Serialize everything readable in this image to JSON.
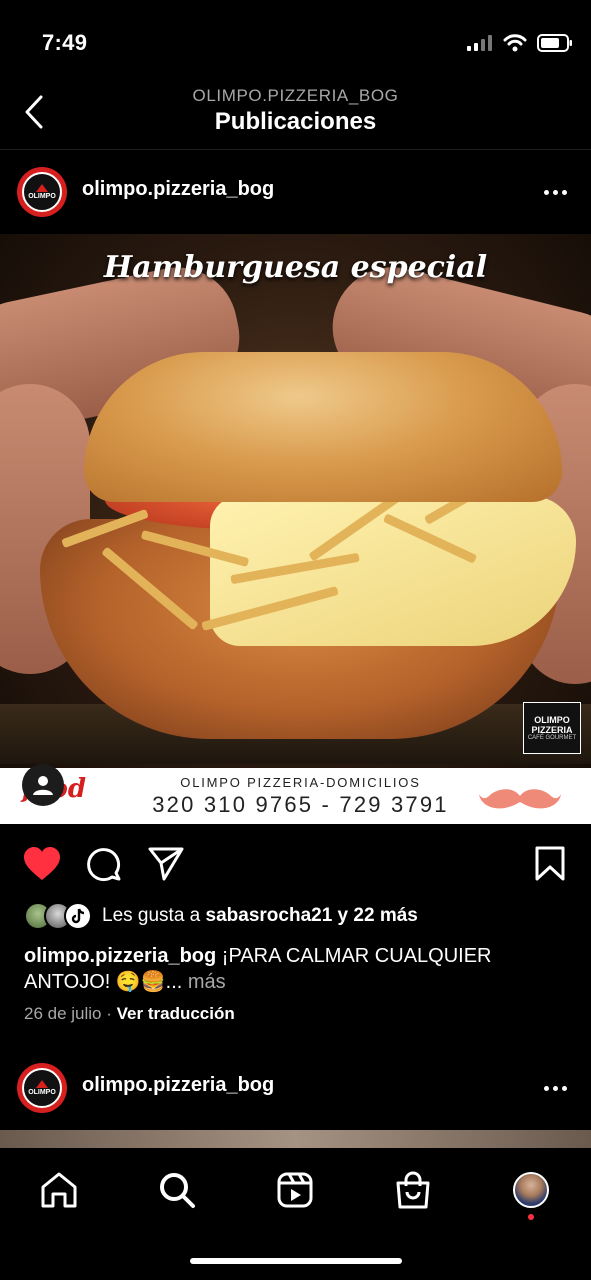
{
  "status_bar": {
    "time": "7:49"
  },
  "header": {
    "subtitle": "OLIMPO.PIZZERIA_BOG",
    "title": "Publicaciones"
  },
  "post": {
    "username": "olimpo.pizzeria_bog",
    "image_title": "Hamburguesa especial",
    "logo_text": [
      "OLIMPO",
      "PIZZERIA",
      "CAFÉ GOURMET"
    ],
    "promo": {
      "brand": "food",
      "name": "OLIMPO PIZZERIA-DOMICILIOS",
      "phones": "320 310 9765 - 729 3791"
    },
    "liked": true,
    "likes": {
      "prefix": "Les gusta a ",
      "user": "sabasrocha21",
      "suffix": " y 22 más"
    },
    "caption": {
      "username": "olimpo.pizzeria_bog",
      "text": " ¡PARA CALMAR CUALQUIER ANTOJO! 🤤🍔...",
      "more": " más"
    },
    "date": "26 de julio",
    "translate": "Ver traducción"
  },
  "post2": {
    "username": "olimpo.pizzeria_bog"
  },
  "colors": {
    "like_red": "#ff3040",
    "brand_red": "#d61f1f",
    "secondary_text": "#a8a8a8"
  },
  "icons": {
    "status": [
      "signal-icon",
      "wifi-icon",
      "battery-icon"
    ],
    "actions": [
      "heart-icon",
      "comment-icon",
      "share-icon",
      "bookmark-icon"
    ],
    "bottom_nav": [
      "home-icon",
      "search-icon",
      "reels-icon",
      "shop-icon",
      "profile-avatar"
    ]
  }
}
